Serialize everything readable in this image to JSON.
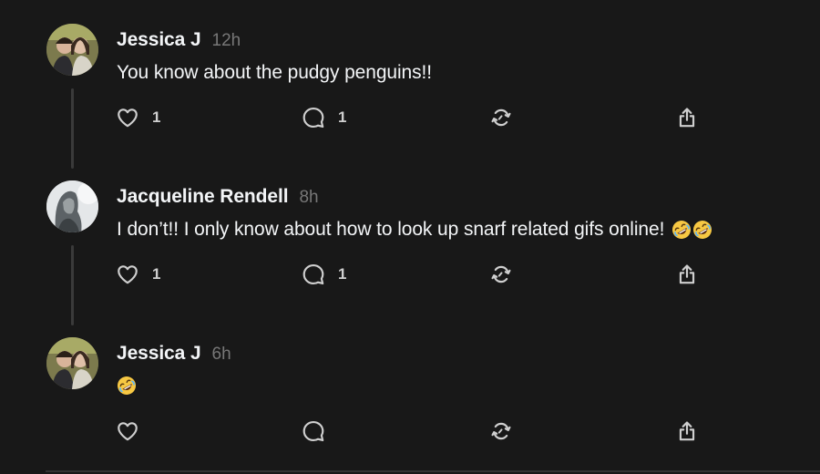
{
  "posts": [
    {
      "author": "Jessica J",
      "time": "12h",
      "text": "You know about the pudgy penguins!!",
      "emojis": [],
      "like_count": "1",
      "reply_count": "1",
      "avatar": "couple-photo-avatar"
    },
    {
      "author": "Jacqueline Rendell",
      "time": "8h",
      "text": "I don’t!! I only know about how to look up snarf related gifs online!",
      "emojis": [
        "rolling-on-floor-laughing",
        "rolling-on-floor-laughing"
      ],
      "like_count": "1",
      "reply_count": "1",
      "avatar": "person-photo-avatar"
    },
    {
      "author": "Jessica J",
      "time": "6h",
      "text": "",
      "emojis": [
        "rolling-on-floor-laughing"
      ],
      "like_count": "",
      "reply_count": "",
      "avatar": "couple-photo-avatar"
    }
  ],
  "icons": {
    "like": "heart-icon",
    "reply": "comment-bubble-icon",
    "repost": "repost-arrows-icon",
    "share": "share-upload-icon"
  },
  "colors": {
    "background": "#181818",
    "text": "#f3f5f7",
    "muted": "#777777",
    "icon": "#cfcfcf",
    "thread_line": "#3a3a3a"
  }
}
